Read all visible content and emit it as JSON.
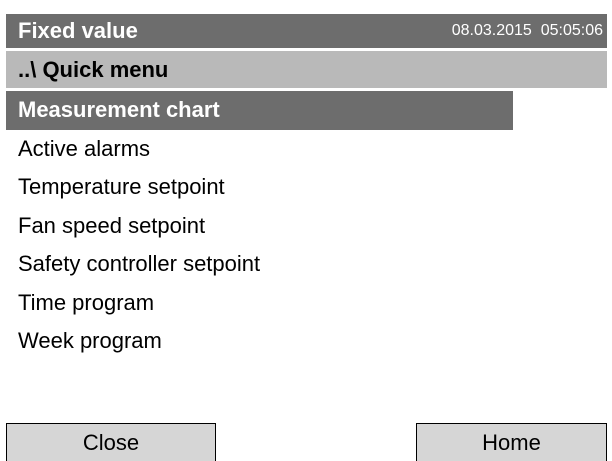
{
  "header": {
    "title": "Fixed value",
    "datetime": "08.03.2015  05:05:06"
  },
  "breadcrumb": "..\\ Quick menu",
  "menu": {
    "selected_index": 0,
    "items": [
      {
        "label": "Measurement chart"
      },
      {
        "label": "Active alarms"
      },
      {
        "label": "Temperature setpoint"
      },
      {
        "label": "Fan speed setpoint"
      },
      {
        "label": "Safety controller setpoint"
      },
      {
        "label": "Time program"
      },
      {
        "label": "Week program"
      }
    ]
  },
  "footer": {
    "close_label": "Close",
    "home_label": "Home"
  },
  "colors": {
    "titlebar_bg": "#6d6d6d",
    "breadcrumb_bg": "#b9b9b9",
    "selected_bg": "#6d6d6d",
    "button_bg": "#d6d6d6"
  }
}
